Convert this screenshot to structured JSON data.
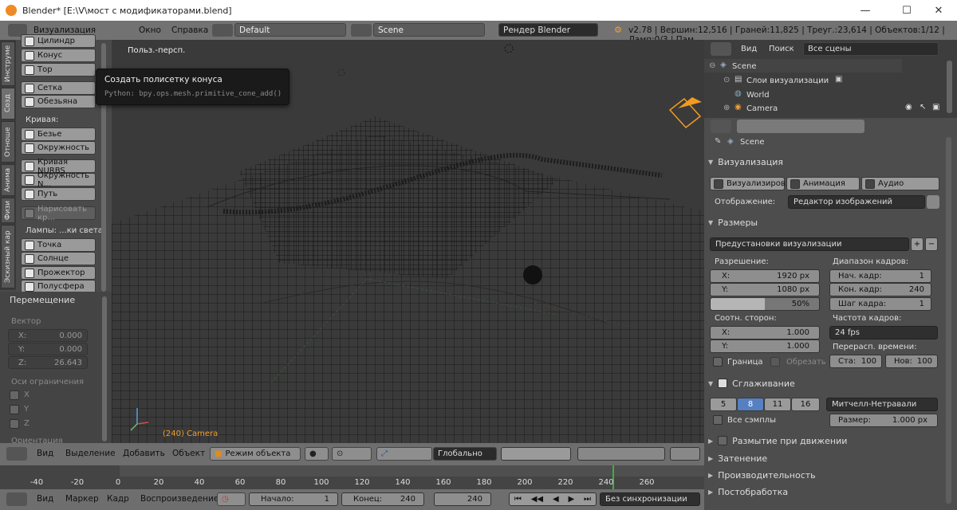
{
  "window": {
    "title": "Blender* [E:\\V\\мост с модификаторами.blend]",
    "min": "—",
    "max": "☐",
    "close": "✕"
  },
  "infobar": {
    "menus": [
      "Визуализация",
      "Окно",
      "Справка"
    ],
    "layout": "Default",
    "scene": "Scene",
    "engine": "Рендер Blender",
    "stats": "v2.78 | Вершин:12,516 | Граней:11,825 | Треуг.:23,614 | Объектов:1/12 | Ламп:0/3 | Пам"
  },
  "tabs": [
    "Инструме",
    "Созд",
    "Отноше",
    "Анима",
    "Физи",
    "Эскизный кар"
  ],
  "create": {
    "cylinder": "Цилиндр",
    "cone": "Конус",
    "torus": "Тор",
    "grid": "Сетка",
    "monkey": "Обезьяна",
    "curve_label": "Кривая:",
    "bezier": "Безье",
    "circle": "Окружность",
    "nurbs_curve": "Кривая NURBS",
    "nurbs_circle": "Окружность N...",
    "path": "Путь",
    "draw_curve": "Нарисовать кр...",
    "lamps_label": "Лампы: ...ки света",
    "point": "Точка",
    "sun": "Солнце",
    "spot": "Прожектор",
    "hemi": "Полусфера"
  },
  "operator": {
    "title": "Перемещение",
    "vector": "Вектор",
    "x_label": "X:",
    "x": "0.000",
    "y_label": "Y:",
    "y": "0.000",
    "z_label": "Z:",
    "z": "26.643",
    "constraint": "Оси ограничения",
    "cx": "X",
    "cy": "Y",
    "cz": "Z",
    "orientation": "Ориентация"
  },
  "tooltip": {
    "title": "Создать полисетку конуса",
    "python": "Python: bpy.ops.mesh.primitive_cone_add()"
  },
  "viewport": {
    "view_name": "Польз.-персп.",
    "object_info": "(240) Camera"
  },
  "vp_header": {
    "menus": [
      "Вид",
      "Выделение",
      "Добавить",
      "Объект"
    ],
    "mode": "Режим объекта",
    "orientation": "Глобально"
  },
  "timeline": {
    "ticks": [
      "-40",
      "-20",
      "0",
      "20",
      "40",
      "60",
      "80",
      "100",
      "120",
      "140",
      "160",
      "180",
      "200",
      "220",
      "240",
      "260"
    ]
  },
  "tl_header": {
    "menus": [
      "Вид",
      "Маркер",
      "Кадр",
      "Воспроизведение"
    ],
    "start_label": "Начало:",
    "start": "1",
    "end_label": "Конец:",
    "end": "240",
    "current": "240",
    "sync": "Без синхронизации"
  },
  "outliner": {
    "menus": [
      "Вид",
      "Поиск"
    ],
    "filter": "Все сцены",
    "items": [
      "Scene",
      "Слои визуализации",
      "World",
      "Camera"
    ]
  },
  "properties": {
    "context": "Scene",
    "render_section": "Визуализация",
    "render_btn": "Визуализиров...",
    "anim_btn": "Анимация",
    "audio_btn": "Аудио",
    "display_label": "Отображение:",
    "display": "Редактор изображений",
    "dims_section": "Размеры",
    "presets": "Предустановки визуализации",
    "res_label": "Разрешение:",
    "res_x_label": "X:",
    "res_x": "1920 px",
    "res_y_label": "Y:",
    "res_y": "1080 px",
    "res_pct": "50%",
    "range_label": "Диапазон кадров:",
    "start_label": "Нач. кадр:",
    "start": "1",
    "end_label": "Кон. кадр:",
    "end": "240",
    "step_label": "Шаг кадра:",
    "step": "1",
    "aspect_label": "Соотн. сторон:",
    "asp_x_label": "X:",
    "asp_x": "1.000",
    "asp_y_label": "Y:",
    "asp_y": "1.000",
    "fps_label": "Частота кадров:",
    "fps": "24 fps",
    "remap_label": "Перерасп. времени:",
    "old_label": "Ста:",
    "old": "100",
    "new_label": "Нов:",
    "new": "100",
    "border": "Граница",
    "crop": "Обрезать",
    "aa_section": "Сглаживание",
    "aa_samples": [
      "5",
      "8",
      "11",
      "16"
    ],
    "aa_filter": "Митчелл-Нетравали",
    "full_sample": "Все сэмплы",
    "size_label": "Размер:",
    "size": "1.000 px",
    "motion_blur": "Размытие при движении",
    "shading": "Затенение",
    "performance": "Производительность",
    "post": "Постобработка"
  }
}
